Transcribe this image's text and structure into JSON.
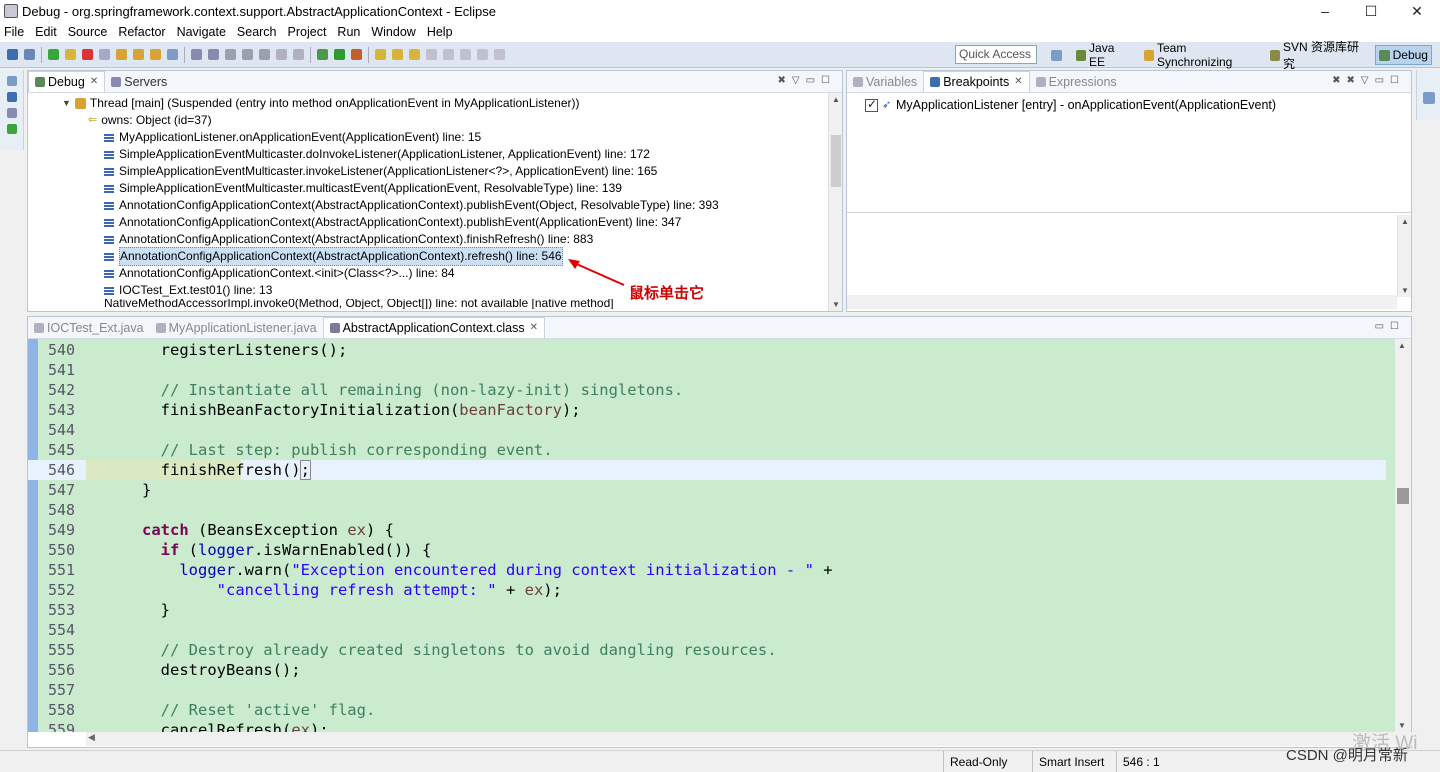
{
  "window": {
    "title": "Debug - org.springframework.context.support.AbstractApplicationContext - Eclipse",
    "controls": [
      "–",
      "☐",
      "✕"
    ]
  },
  "menu": [
    "File",
    "Edit",
    "Source",
    "Refactor",
    "Navigate",
    "Search",
    "Project",
    "Run",
    "Window",
    "Help"
  ],
  "toolbar": {
    "quick_access_placeholder": "Quick Access",
    "perspectives": [
      {
        "label": "Java EE",
        "icon": "java-ee-perspective-icon",
        "active": false
      },
      {
        "label": "Team Synchronizing",
        "icon": "team-sync-perspective-icon",
        "active": false
      },
      {
        "label": "SVN 资源库研究",
        "icon": "svn-perspective-icon",
        "active": false
      },
      {
        "label": "Debug",
        "icon": "debug-perspective-icon",
        "active": true
      }
    ]
  },
  "debug_view": {
    "tabs": [
      {
        "label": "Debug",
        "active": true
      },
      {
        "label": "Servers",
        "active": false
      }
    ],
    "thread": "Thread [main] (Suspended (entry into method onApplicationEvent in MyApplicationListener))",
    "owns": "owns: Object  (id=37)",
    "frames": [
      "MyApplicationListener.onApplicationEvent(ApplicationEvent) line: 15",
      "SimpleApplicationEventMulticaster.doInvokeListener(ApplicationListener, ApplicationEvent) line: 172",
      "SimpleApplicationEventMulticaster.invokeListener(ApplicationListener<?>, ApplicationEvent) line: 165",
      "SimpleApplicationEventMulticaster.multicastEvent(ApplicationEvent, ResolvableType) line: 139",
      "AnnotationConfigApplicationContext(AbstractApplicationContext).publishEvent(Object, ResolvableType) line: 393",
      "AnnotationConfigApplicationContext(AbstractApplicationContext).publishEvent(ApplicationEvent) line: 347",
      "AnnotationConfigApplicationContext(AbstractApplicationContext).finishRefresh() line: 883",
      "AnnotationConfigApplicationContext(AbstractApplicationContext).refresh() line: 546",
      "AnnotationConfigApplicationContext.<init>(Class<?>...) line: 84",
      "IOCTest_Ext.test01() line: 13",
      "NativeMethodAccessorImpl.invoke0(Method, Object, Object[]) line: not available [native method]"
    ],
    "selected_index": 7,
    "annotation": "鼠标单击它"
  },
  "breakpoints_view": {
    "tabs": [
      {
        "label": "Variables",
        "active": false
      },
      {
        "label": "Breakpoints",
        "active": true
      },
      {
        "label": "Expressions",
        "active": false
      }
    ],
    "items": [
      {
        "label": "MyApplicationListener [entry] - onApplicationEvent(ApplicationEvent)",
        "checked": true
      }
    ]
  },
  "editor": {
    "tabs": [
      {
        "label": "IOCTest_Ext.java",
        "active": false
      },
      {
        "label": "MyApplicationListener.java",
        "active": false
      },
      {
        "label": "AbstractApplicationContext.class",
        "active": true
      }
    ],
    "current_line": 546,
    "lines": [
      {
        "n": "540",
        "text": "\t\t\t\tregisterListeners();"
      },
      {
        "n": "541",
        "text": ""
      },
      {
        "n": "542",
        "text": "\t\t\t\t// Instantiate all remaining (non-lazy-init) singletons."
      },
      {
        "n": "543",
        "text": "\t\t\t\tfinishBeanFactoryInitialization(beanFactory);"
      },
      {
        "n": "544",
        "text": ""
      },
      {
        "n": "545",
        "text": "\t\t\t\t// Last step: publish corresponding event."
      },
      {
        "n": "546",
        "text": "\t\t\t\tfinishRefresh();"
      },
      {
        "n": "547",
        "text": "\t\t\t}"
      },
      {
        "n": "548",
        "text": ""
      },
      {
        "n": "549",
        "text": "\t\t\tcatch (BeansException ex) {"
      },
      {
        "n": "550",
        "text": "\t\t\t\tif (logger.isWarnEnabled()) {"
      },
      {
        "n": "551",
        "text": "\t\t\t\t\tlogger.warn(\"Exception encountered during context initialization - \" +"
      },
      {
        "n": "552",
        "text": "\t\t\t\t\t\t\t\"cancelling refresh attempt: \" + ex);"
      },
      {
        "n": "553",
        "text": "\t\t\t\t}"
      },
      {
        "n": "554",
        "text": ""
      },
      {
        "n": "555",
        "text": "\t\t\t\t// Destroy already created singletons to avoid dangling resources."
      },
      {
        "n": "556",
        "text": "\t\t\t\tdestroyBeans();"
      },
      {
        "n": "557",
        "text": ""
      },
      {
        "n": "558",
        "text": "\t\t\t\t// Reset 'active' flag."
      },
      {
        "n": "559",
        "text": "\t\t\t\tcancelRefresh(ex);"
      }
    ]
  },
  "status": {
    "mode": "Read-Only",
    "insert": "Smart Insert",
    "position": "546 : 1",
    "watermark": "CSDN @明月常新",
    "watermark_faint": "激活 Wi"
  },
  "colors": {
    "editor_bg": "#cbebcf",
    "current_line": "#e8f2fe",
    "keyword": "#7f0055",
    "comment": "#3f7f5f",
    "string": "#2a00ff",
    "field": "#0000c0",
    "annotation": "#d00000"
  }
}
